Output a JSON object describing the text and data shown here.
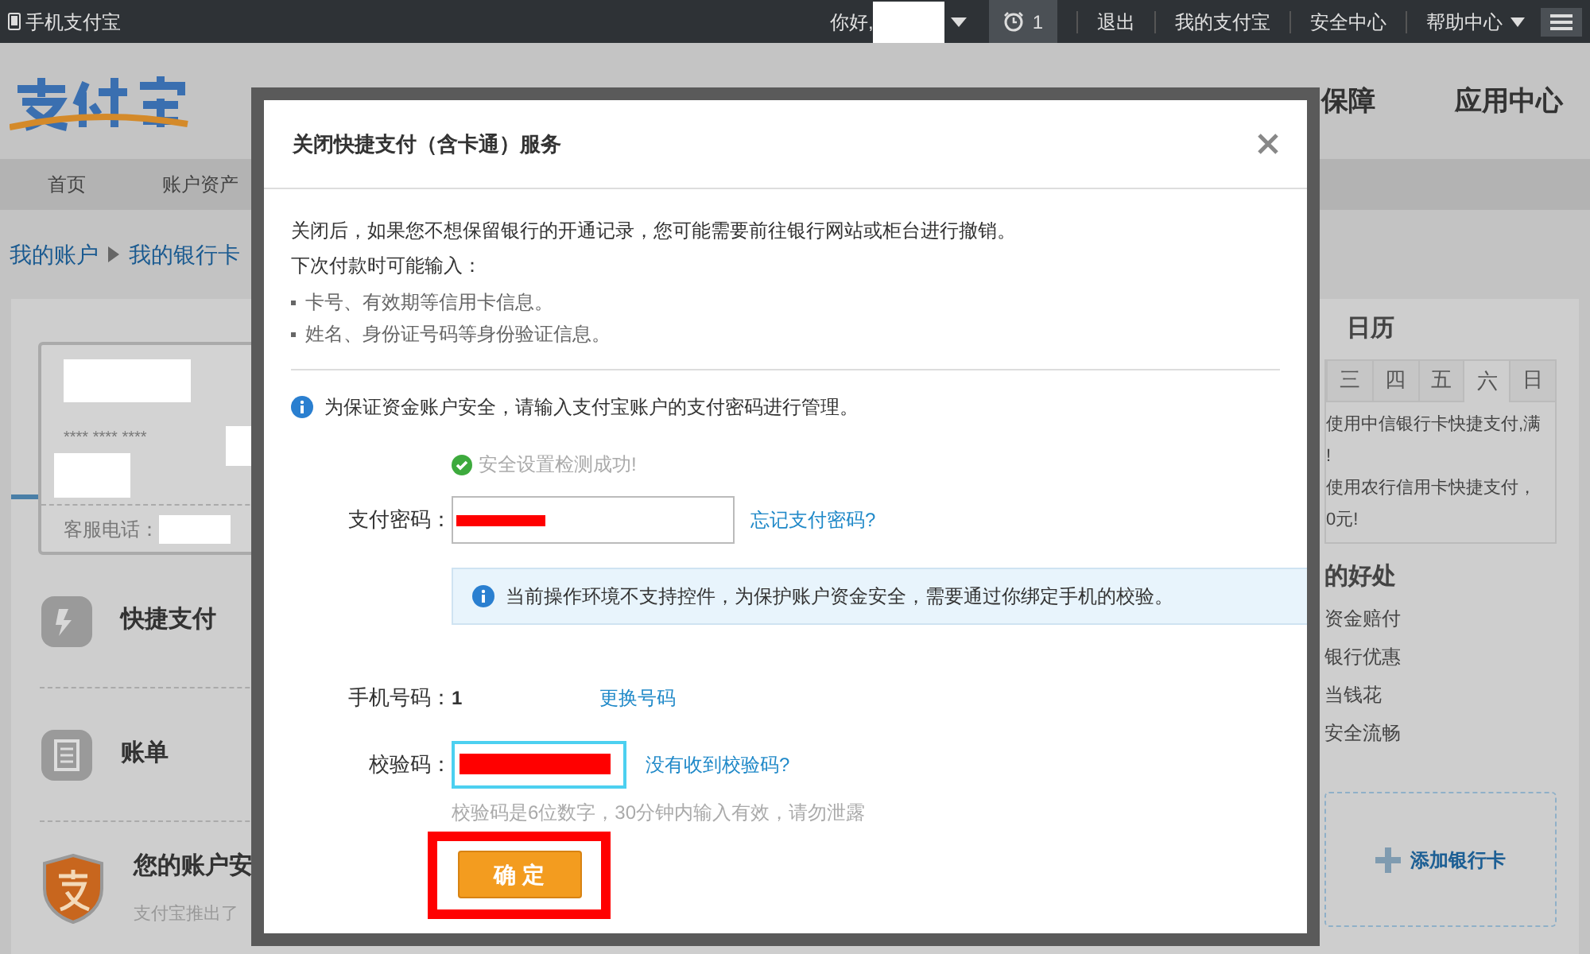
{
  "topbar": {
    "app_link": "手机支付宝",
    "greeting": "你好,",
    "alarm_count": "1",
    "links": [
      "退出",
      "我的支付宝",
      "安全中心",
      "帮助中心"
    ]
  },
  "header": {
    "nav_right": [
      "保障",
      "应用中心"
    ]
  },
  "nav": [
    "首页",
    "账户资产"
  ],
  "breadcrumb": [
    "我的账户",
    "我的银行卡"
  ],
  "card": {
    "masked_number": "**** **** ****",
    "phone_label": "客服电话："
  },
  "left_items": [
    {
      "kind": "quick",
      "title": "快捷支付"
    },
    {
      "kind": "bill",
      "title": "账单"
    },
    {
      "kind": "shield",
      "title": "您的账户安",
      "subtitle": "支付宝推出了"
    }
  ],
  "right": {
    "calendar_title": "日历",
    "weekdays": [
      {
        "label": "三",
        "selected": false
      },
      {
        "label": "四",
        "selected": false
      },
      {
        "label": "五",
        "selected": false
      },
      {
        "label": "六",
        "selected": true
      },
      {
        "label": "日",
        "selected": false
      }
    ],
    "promos": [
      "使用中信银行卡快捷支付,满",
      "!",
      "使用农行信用卡快捷支付，",
      "0元!"
    ],
    "benefits_title": "的好处",
    "benefits": [
      "资金赔付",
      "银行优惠",
      "当钱花",
      "安全流畅"
    ],
    "add_card": "添加银行卡"
  },
  "dialog": {
    "title": "关闭快捷支付（含卡通）服务",
    "intro": "关闭后，如果您不想保留银行的开通记录，您可能需要前往银行网站或柜台进行撤销。",
    "subhead": "下次付款时可能输入：",
    "bullets": [
      "卡号、有效期等信用卡信息。",
      "姓名、身份证号码等身份验证信息。"
    ],
    "notice": "为保证资金账户安全，请输入支付宝账户的支付密码进行管理。",
    "check_message": "安全设置检测成功!",
    "password_label": "支付密码：",
    "forgot_link": "忘记支付密码?",
    "warning": "当前操作环境不支持控件，为保护账户资金安全，需要通过你绑定手机的校验。",
    "phone_label": "手机号码：",
    "phone_value": "1",
    "change_link": "更换号码",
    "code_label": "校验码：",
    "no_code_link": "没有收到校验码?",
    "hint": "校验码是6位数字，30分钟内输入有效，请勿泄露",
    "confirm": "确 定",
    "highlighted": true
  }
}
